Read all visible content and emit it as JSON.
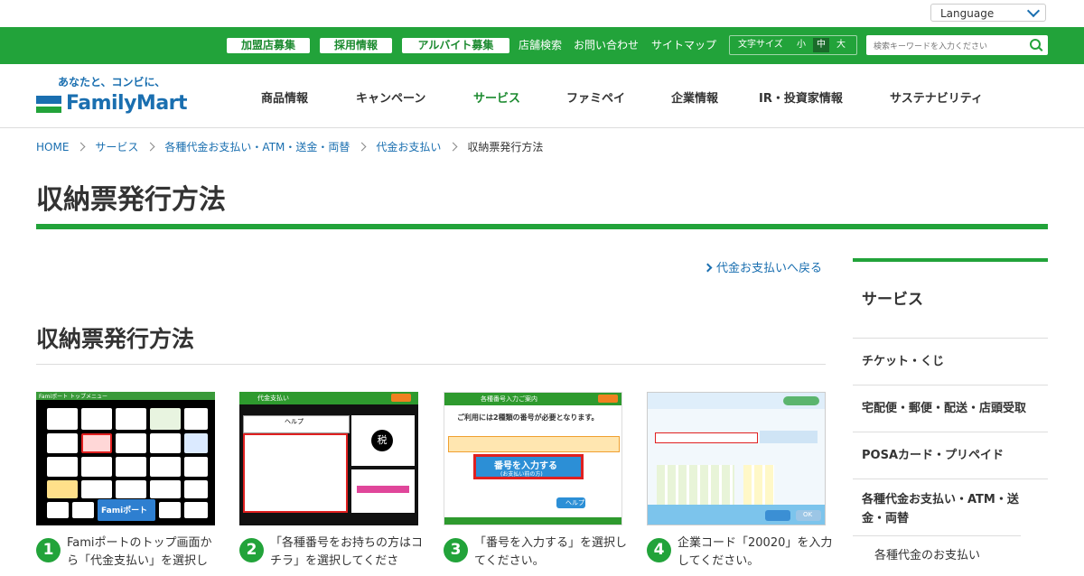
{
  "language": {
    "label": "Language"
  },
  "topbar": {
    "pills": [
      "加盟店募集",
      "採用情報",
      "アルバイト募集"
    ],
    "links": [
      "店舗検索",
      "お問い合わせ",
      "サイトマップ"
    ],
    "font_size": {
      "label": "文字サイズ",
      "small": "小",
      "medium": "中",
      "large": "大"
    },
    "search_placeholder": "検索キーワードを入力ください"
  },
  "logo": {
    "tagline": "あなたと、コンビに、",
    "name": "FamilyMart"
  },
  "nav": [
    "商品情報",
    "キャンペーン",
    "サービス",
    "ファミペイ",
    "企業情報",
    "IR・投資家情報",
    "サステナビリティ"
  ],
  "breadcrumb": [
    "HOME",
    "サービス",
    "各種代金お支払い・ATM・送金・両替",
    "代金お支払い",
    "収納票発行方法"
  ],
  "page_title": "収納票発行方法",
  "back_link": "代金お支払いへ戻る",
  "section_title": "収納票発行方法",
  "steps": [
    {
      "num": "1",
      "text": "Famiポートのトップ画面から「代金支払い」を選択し"
    },
    {
      "num": "2",
      "text": "「各種番号をお持ちの方はコチラ」を選択してくださ"
    },
    {
      "num": "3",
      "text": "「番号を入力する」を選択してください。"
    },
    {
      "num": "4",
      "text": "企業コード「20020」を入力してください。"
    }
  ],
  "sidebar": {
    "heading": "サービス",
    "items": [
      "チケット・くじ",
      "宅配便・郵便・配送・店頭受取",
      "POSAカード・プリペイド",
      "各種代金お支払い・ATM・送金・両替",
      "各種代金のお支払い"
    ]
  },
  "shots": {
    "s1_header": "Famiポート トップメニュー",
    "s1_brand": "Famiポート",
    "s2_header": "代金支払い",
    "s2_help": "ヘルプ",
    "s2_tax": "税",
    "s3_header": "各種番号入力ご案内",
    "s3_title": "ご利用には2種類の番号が必要となります。",
    "s3_button": "番号を入力する",
    "s3_button_sub": "(お支払い前の方)",
    "s3_help": "ヘルプ",
    "s4_ok": "OK"
  },
  "colors": {
    "brand_green": "#22a33a",
    "brand_blue": "#1a6fb0"
  }
}
